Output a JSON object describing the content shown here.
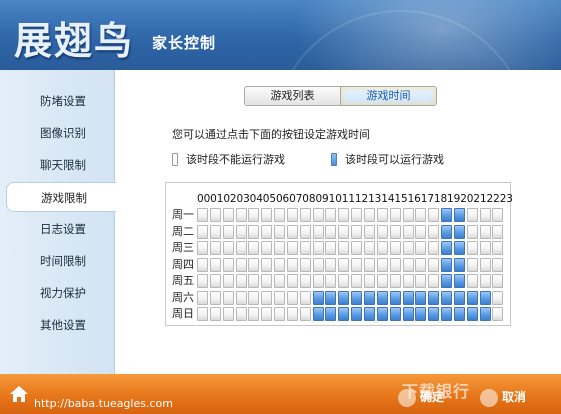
{
  "header": {
    "logo_text": "展翅鸟",
    "subtitle": "家长控制"
  },
  "sidebar": {
    "items": [
      {
        "label": "防堵设置"
      },
      {
        "label": "图像识别"
      },
      {
        "label": "聊天限制"
      },
      {
        "label": "游戏限制",
        "active": true
      },
      {
        "label": "日志设置"
      },
      {
        "label": "时间限制"
      },
      {
        "label": "视力保护"
      },
      {
        "label": "其他设置"
      }
    ]
  },
  "tabs": [
    {
      "label": "游戏列表",
      "active": false
    },
    {
      "label": "游戏时间",
      "active": true
    }
  ],
  "hint": "您可以通过点击下面的按钮设定游戏时间",
  "legend": {
    "off_label": "该时段不能运行游戏",
    "on_label": "该时段可以运行游戏"
  },
  "schedule": {
    "hours_header": "000102030405060708091011121314151617181920212223",
    "days": [
      {
        "label": "周一",
        "allowed_hours": [
          19,
          20
        ]
      },
      {
        "label": "周二",
        "allowed_hours": [
          19,
          20
        ]
      },
      {
        "label": "周三",
        "allowed_hours": [
          19,
          20
        ]
      },
      {
        "label": "周四",
        "allowed_hours": [
          19,
          20
        ]
      },
      {
        "label": "周五",
        "allowed_hours": [
          19,
          20
        ]
      },
      {
        "label": "周六",
        "allowed_hours": [
          9,
          10,
          11,
          12,
          13,
          14,
          15,
          16,
          17,
          18,
          19,
          20,
          21,
          22
        ]
      },
      {
        "label": "周日",
        "allowed_hours": [
          9,
          10,
          11,
          12,
          13,
          14,
          15,
          16,
          17,
          18,
          19,
          20,
          21,
          22
        ]
      }
    ],
    "colors": {
      "allowed": "#5b9be3",
      "blocked": "#f2f2f2"
    }
  },
  "footer": {
    "url": "http://baba.tueagles.com",
    "ok_label": "确定",
    "cancel_label": "取消",
    "watermark": "下载银行"
  }
}
